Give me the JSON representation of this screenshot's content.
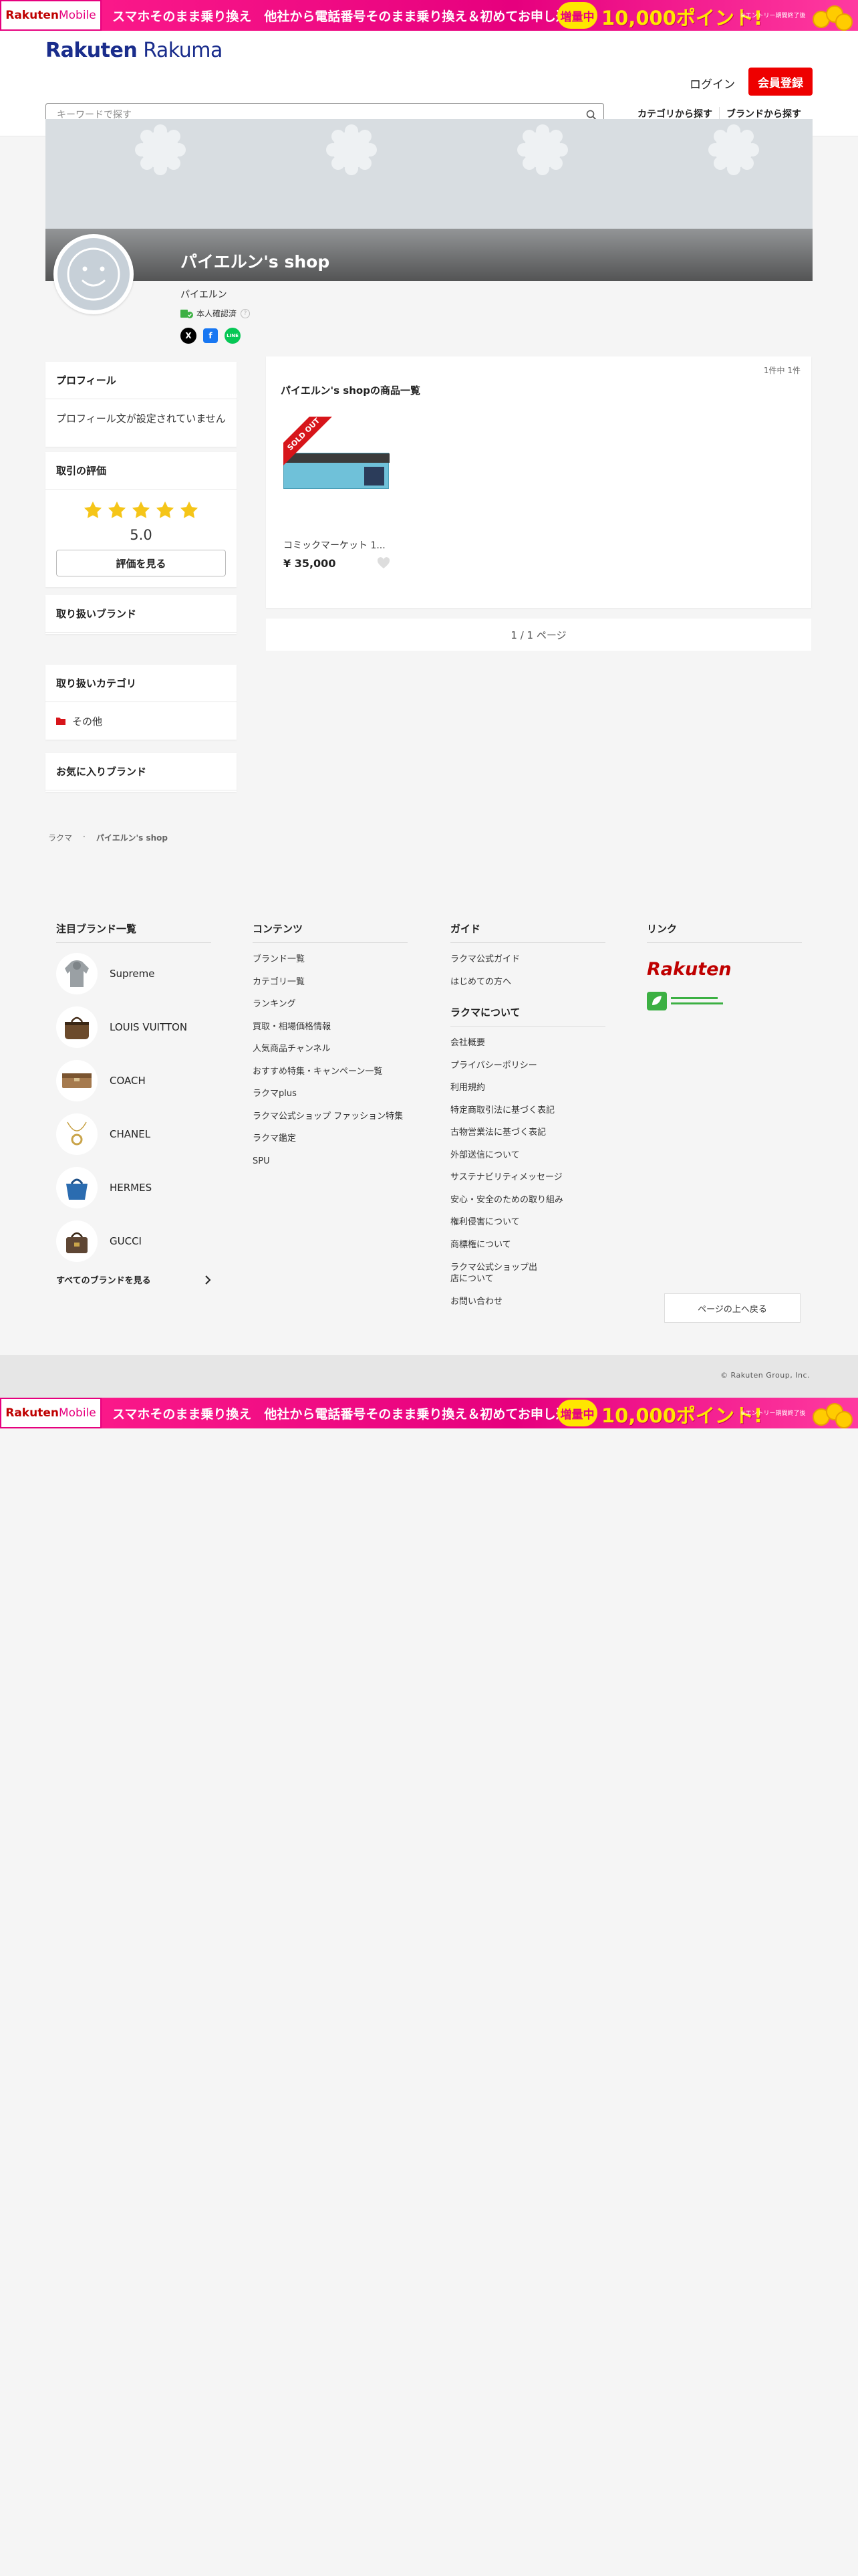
{
  "promo": {
    "brand_main": "Rakuten",
    "brand_sub": "Mobile",
    "text": "スマホそのまま乗り換え　他社から電話番号そのまま乗り換え＆初めてお申し込みで",
    "badge": "増量中",
    "points": "10,000ポイント!",
    "small": "※エントリー期間終了後"
  },
  "header": {
    "logo_main": "Rakuten",
    "logo_sub": " Rakuma",
    "login": "ログイン",
    "register": "会員登録",
    "search_placeholder": "キーワードで探す",
    "nav": [
      "カテゴリから探す",
      "ブランドから探す"
    ]
  },
  "shop": {
    "name": "パイエルン's shop",
    "owner": "パイエルン",
    "verified": "本人確認済",
    "verified_help": "?",
    "socials": [
      "X",
      "f",
      "LINE"
    ]
  },
  "profile": {
    "title": "プロフィール",
    "text": "プロフィール文が設定されていません"
  },
  "rating": {
    "title": "取引の評価",
    "stars": 5,
    "score": "5.0",
    "button": "評価を見る"
  },
  "brands_panel": {
    "title": "取り扱いブランド"
  },
  "categories_panel": {
    "title": "取り扱いカテゴリ",
    "items": [
      "その他"
    ]
  },
  "favorites_panel": {
    "title": "お気に入りブランド"
  },
  "listing": {
    "count": "1件中 1件",
    "title": "パイエルン's shopの商品一覧",
    "products": [
      {
        "name": "コミックマーケット 1...",
        "price": "¥ 35,000",
        "badge": "SOLD OUT"
      }
    ],
    "pager": "1 / 1 ページ"
  },
  "breadcrumb": [
    "ラクマ",
    "パイエルン's shop"
  ],
  "footer": {
    "brands_title": "注目ブランド一覧",
    "brands": [
      "Supreme",
      "LOUIS VUITTON",
      "COACH",
      "CHANEL",
      "HERMES",
      "GUCCI"
    ],
    "all_brands": "すべてのブランドを見る",
    "contents_title": "コンテンツ",
    "contents": [
      "ブランド一覧",
      "カテゴリ一覧",
      "ランキング",
      "買取・相場価格情報",
      "人気商品チャンネル",
      "おすすめ特集・キャンペーン一覧",
      "ラクマplus",
      "ラクマ公式ショップ ファッション特集",
      "ラクマ鑑定",
      "SPU"
    ],
    "guide_title": "ガイド",
    "guide": [
      "ラクマ公式ガイド",
      "はじめての方へ"
    ],
    "about_title": "ラクマについて",
    "about": [
      "会社概要",
      "プライバシーポリシー",
      "利用規約",
      "特定商取引法に基づく表記",
      "古物営業法に基づく表記",
      "外部送信について",
      "サステナビリティメッセージ",
      "安心・安全のための取り組み",
      "権利侵害について",
      "商標権について",
      "ラクマ公式ショップ出店について",
      "お問い合わせ"
    ],
    "links_title": "リンク",
    "links_logo": "Rakuten",
    "to_top": "ページの上へ戻る",
    "copyright": "© Rakuten Group, Inc."
  },
  "colors": {
    "accent": "#e00000",
    "brand_blue": "#1a2d8c",
    "promo_pink": "#e6007e",
    "star": "#f5c518"
  }
}
